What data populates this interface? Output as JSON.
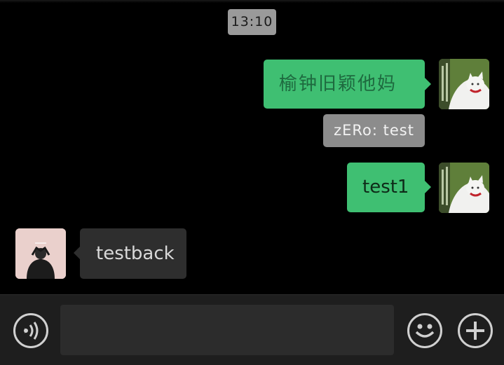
{
  "chat": {
    "timestamp": "13:10",
    "messages": [
      {
        "side": "out",
        "text": "榆钟旧颖他妈",
        "avatar": "cat-avatar"
      },
      {
        "side": "out-quote",
        "text": "zERo: test"
      },
      {
        "side": "out",
        "text": "test1",
        "avatar": "cat-avatar"
      },
      {
        "side": "in",
        "text": "testback",
        "avatar": "person-avatar"
      }
    ]
  },
  "input_bar": {
    "voice_icon": "voice-icon",
    "emoji_icon": "emoji-icon",
    "plus_icon": "plus-icon",
    "message_value": ""
  },
  "colors": {
    "outgoing_bubble": "#3fbf72",
    "incoming_bubble": "#2e2e2e",
    "background": "#000000",
    "bottom_bar": "#1e1e1e"
  }
}
